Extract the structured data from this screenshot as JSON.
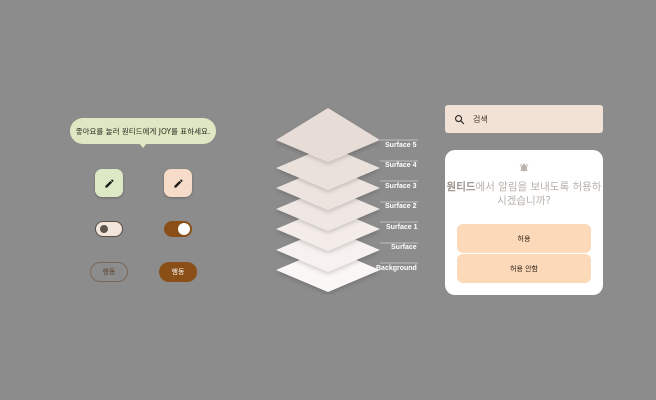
{
  "tooltip": {
    "text": "좋아요를 눌러 원티드에게 JOY를 표하세요."
  },
  "buttons": {
    "edit_a_icon": "pencil-icon",
    "edit_b_icon": "pencil-icon"
  },
  "switches": {
    "first_on": false,
    "second_on": true
  },
  "chips": {
    "outline_label": "행동",
    "filled_label": "행동"
  },
  "surfaces": {
    "labels": [
      "Surface 5",
      "Surface 4",
      "Surface 3",
      "Surface 2",
      "Surface 1",
      "Surface",
      "Background"
    ]
  },
  "search": {
    "icon": "search-icon",
    "placeholder": "검색"
  },
  "dialog": {
    "icon": "bell-icon",
    "brand": "원티드",
    "message_rest": "에서 알림을 보내도록 허용하시겠습니까?",
    "allow_label": "허용",
    "deny_label": "허용 안함"
  },
  "colors": {
    "background": "#8c8c8c",
    "tooltip": "#dfe8c3",
    "accent": "#8a4f16",
    "dialog_button": "#fcd9b8",
    "search": "#f2e2d6"
  }
}
